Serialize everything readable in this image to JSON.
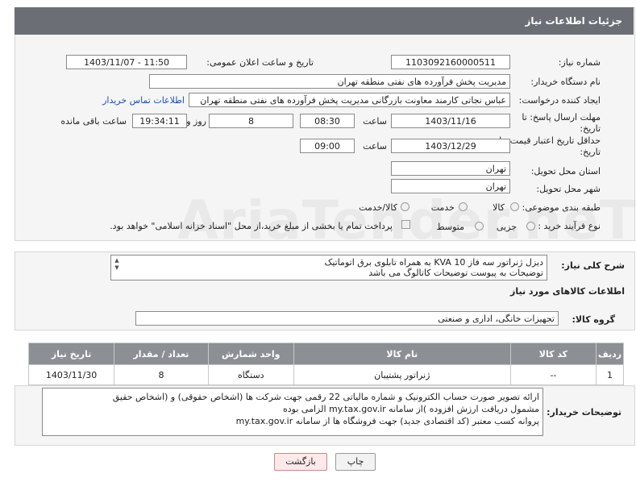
{
  "header": {
    "title": "جزئیات اطلاعات نیاز"
  },
  "form": {
    "need_number_label": "شماره نیاز:",
    "need_number": "1103092160000511",
    "announce_label": "تاریخ و ساعت اعلان عمومی:",
    "announce_value": "1403/11/07 - 11:50",
    "buyer_org_label": "نام دستگاه خریدار:",
    "buyer_org": "مدیریت پخش فرآورده های نفتی منطقه تهران",
    "requester_label": "ایجاد کننده درخواست:",
    "requester": "عباس نجاتی کارمند معاونت بازرگانی مدیریت پخش فرآورده های نفتی منطقه تهران",
    "contact_link": "اطلاعات تماس خریدار",
    "deadline_label": "مهلت ارسال پاسخ: تا تاریخ:",
    "deadline_date": "1403/11/16",
    "time_label": "ساعت",
    "deadline_time": "08:30",
    "days_value": "8",
    "days_label": "روز و",
    "remaining_time": "19:34:11",
    "remaining_label": "ساعت باقی مانده",
    "validity_label": "حداقل تاریخ اعتبار قیمت: تا تاریخ:",
    "validity_date": "1403/12/29",
    "validity_time": "09:00",
    "province_label": "استان محل تحویل:",
    "province": "تهران",
    "city_label": "شهر محل تحویل:",
    "city": "تهران",
    "category_label": "طبقه بندی موضوعی:",
    "category_options": [
      "کالا",
      "خدمت",
      "کالا/خدمت"
    ],
    "process_label": "نوع فرآیند خرید :",
    "process_options": [
      "جزیی",
      "متوسط"
    ],
    "payment_note": "پرداخت تمام یا بخشی از مبلغ خرید،از محل \"اسناد خزانه اسلامی\" خواهد بود."
  },
  "description": {
    "label": "شرح کلی نیاز:",
    "line1": "دیزل ژنراتور سه فاز KVA 10 به همراه تابلوی برق اتوماتیک",
    "line2": "توضیحات به پیوست توضیحات کاتالوگ می باشد"
  },
  "goods": {
    "section_title": "اطلاعات کالاهای مورد نیاز",
    "group_label": "گروه کالا:",
    "group_value": "تجهیزات خانگی، اداری و صنعتی",
    "columns": [
      "ردیف",
      "کد کالا",
      "نام کالا",
      "واحد شمارش",
      "تعداد / مقدار",
      "تاریخ نیاز"
    ],
    "rows": [
      [
        "1",
        "--",
        "ژنراتور پشتیبان",
        "دستگاه",
        "8",
        "1403/11/30"
      ]
    ]
  },
  "buyer_notes": {
    "label": "توضیحات خریدار:",
    "line1": "ارائه  تصویر صورت حساب الکترونیک و شماره مالیاتی 22 رقمی  جهت شرکت ها (اشخاص حقوقی) و (اشخاص حقیق",
    "line2": "مشمول دریافت ارزش افزوده )از سامانه my.tax.gov.ir  الزامی بوده",
    "line3": "پروانه کسب معتبر (کد اقتصادی جدید) جهت فروشگاه ها از سامانه my.tax.gov.ir"
  },
  "buttons": {
    "print": "چاپ",
    "back": "بازگشت"
  },
  "watermark": "AriaTender.neT"
}
